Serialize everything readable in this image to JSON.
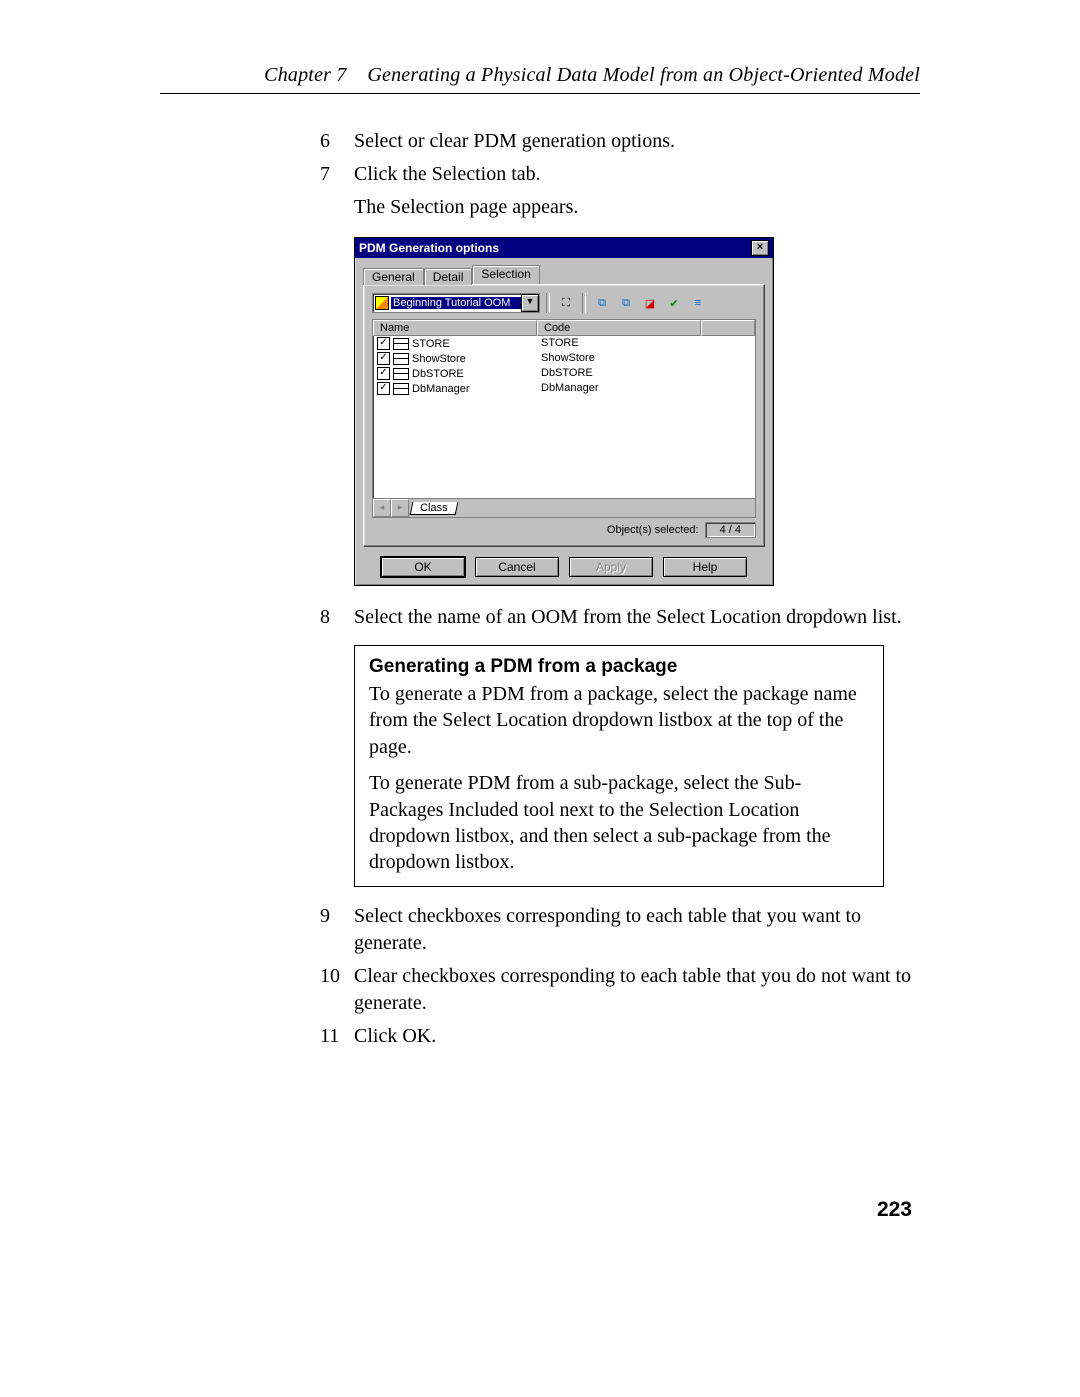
{
  "header": {
    "chapter": "Chapter 7",
    "title": "Generating a Physical Data Model from an Object-Oriented Model"
  },
  "steps": {
    "s6": {
      "num": "6",
      "text": "Select or clear PDM generation options."
    },
    "s7": {
      "num": "7",
      "text": "Click the Selection tab."
    },
    "s7_sub": "The Selection page appears.",
    "s8": {
      "num": "8",
      "text": "Select the name of an OOM from the Select Location dropdown list."
    },
    "s9": {
      "num": "9",
      "text": "Select checkboxes corresponding to each table that you want to generate."
    },
    "s10": {
      "num": "10",
      "text": "Clear checkboxes corresponding to each table that you do not want to generate."
    },
    "s11": {
      "num": "11",
      "text": "Click OK."
    }
  },
  "note": {
    "title": "Generating a PDM from a package",
    "p1": "To generate a PDM from a package, select the package name from the Select Location dropdown listbox at the top of the page.",
    "p2": "To generate PDM from a sub-package, select the Sub-Packages Included tool next to the Selection Location dropdown listbox, and then select a sub-package from the dropdown listbox."
  },
  "dialog": {
    "title": "PDM Generation options",
    "tabs": {
      "general": "General",
      "detail": "Detail",
      "selection": "Selection"
    },
    "combo": "Beginning Tutorial OOM",
    "columns": {
      "name": "Name",
      "code": "Code"
    },
    "rows": [
      {
        "name": "STORE",
        "code": "STORE"
      },
      {
        "name": "ShowStore",
        "code": "ShowStore"
      },
      {
        "name": "DbSTORE",
        "code": "DbSTORE"
      },
      {
        "name": "DbManager",
        "code": "DbManager"
      }
    ],
    "sheet_tab": "Class",
    "status_label": "Object(s) selected:",
    "status_count": "4 / 4",
    "buttons": {
      "ok": "OK",
      "cancel": "Cancel",
      "apply": "Apply",
      "help": "Help"
    }
  },
  "page_number": "223"
}
